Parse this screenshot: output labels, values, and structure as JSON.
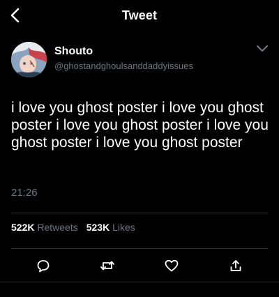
{
  "header": {
    "title": "Tweet",
    "back_icon": "chevron-left-icon"
  },
  "tweet": {
    "author": {
      "display_name": "Shouto",
      "handle": "@ghostandghoulsanddaddyissues"
    },
    "text": "i love you ghost poster i love you ghost poster i love you ghost poster i love you ghost poster i love you ghost poster",
    "timestamp": "21:26"
  },
  "stats": {
    "retweets": {
      "count": "522K",
      "label": "Retweets"
    },
    "likes": {
      "count": "523K",
      "label": "Likes"
    }
  },
  "actions": [
    {
      "name": "reply",
      "icon": "reply-icon"
    },
    {
      "name": "retweet",
      "icon": "retweet-icon"
    },
    {
      "name": "like",
      "icon": "heart-icon"
    },
    {
      "name": "share",
      "icon": "share-icon"
    }
  ],
  "colors": {
    "background": "#000000",
    "text": "#ffffff",
    "secondary_text": "#6e767d",
    "divider": "#2f3336"
  }
}
